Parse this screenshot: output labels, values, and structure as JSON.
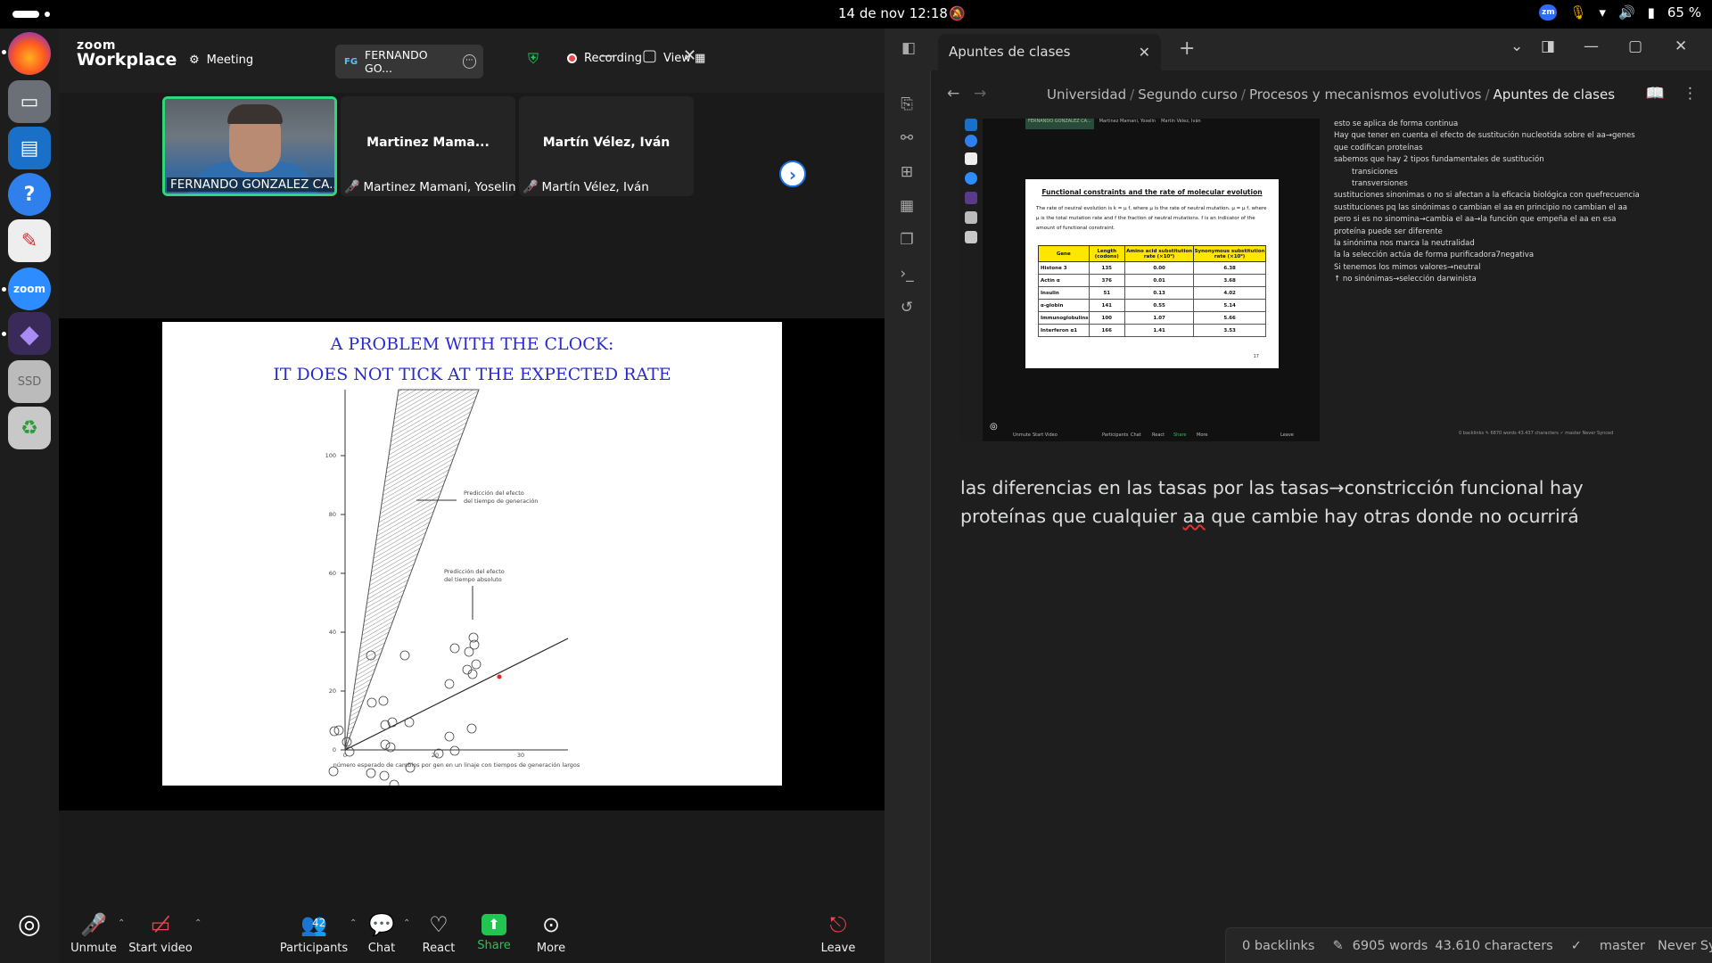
{
  "topbar": {
    "date_time": "14 de nov  12:18",
    "battery": "65 %",
    "zoom_tray": "zm"
  },
  "dock": {
    "items": [
      "firefox-icon",
      "files-icon",
      "writer-icon",
      "help-icon",
      "text-editor-icon",
      "zoom-icon",
      "obsidian-icon",
      "ssd-drive-icon",
      "trash-icon",
      "ubuntu-apps-icon"
    ],
    "zoom_label": "zoom",
    "ssd_label": "SSD"
  },
  "zoom": {
    "logo_top": "zoom",
    "logo_bottom": "Workplace",
    "meeting_label": "Meeting",
    "pill_initials": "FG",
    "pill_name": "FERNANDO GO...",
    "recording_label": "Recording",
    "view_label": "View",
    "participants_tiles": [
      {
        "label": "FERNANDO GONZALEZ CA..."
      },
      {
        "center": "Martinez Mama...",
        "label": "Martinez Mamani, Yoselin"
      },
      {
        "center": "Martín Vélez, Iván",
        "label": "Martín Vélez, Iván"
      }
    ],
    "slide": {
      "title_line1": "A PROBLEM WITH THE CLOCK:",
      "title_line2": "IT DOES NOT TICK AT THE EXPECTED RATE",
      "annotation_generation": "Predicción del efecto\ndel tiempo de generación",
      "annotation_absolute": "Predicción del efecto\ndel tiempo absoluto",
      "xlabel": "número esperado de cambios por gen en un linaje con tiempos de generación largos",
      "y_ticks": [
        "0",
        "20",
        "40",
        "60",
        "80",
        "100"
      ],
      "x_ticks": [
        "0",
        "20",
        "30"
      ]
    },
    "toolbar": {
      "unmute": "Unmute",
      "start_video": "Start video",
      "participants": "Participants",
      "participants_count": "42",
      "chat": "Chat",
      "react": "React",
      "share": "Share",
      "more": "More",
      "leave": "Leave"
    }
  },
  "obsidian": {
    "tab_title": "Apuntes de clases",
    "breadcrumb": [
      "Universidad",
      "Segundo curso",
      "Procesos y mecanismos evolutivos",
      "Apuntes de clases"
    ],
    "embed": {
      "slide_title": "Functional constraints and the rate of molecular evolution",
      "slide_text": "The rate of neutral evolution is k = μ f, where μ is the rate of neutral mutation. μ = μ f, where μ is the total mutation rate and f the fraction of neutral mutations. f is an indicator of the amount of functional constraint.",
      "table_headers": [
        "Gene",
        "Length (codons)",
        "Amino acid substitution rate (×10⁹)",
        "Synonymous substitution rate (×10⁹)"
      ],
      "table_rows": [
        [
          "Histone 3",
          "135",
          "0.00",
          "6.38"
        ],
        [
          "Actin α",
          "376",
          "0.01",
          "3.68"
        ],
        [
          "Insulin",
          "51",
          "0.13",
          "4.02"
        ],
        [
          "α-globin",
          "141",
          "0.55",
          "5.14"
        ],
        [
          "Immunoglobulins",
          "100",
          "1.07",
          "5.66"
        ],
        [
          "Interferon α1",
          "166",
          "1.41",
          "3.53"
        ]
      ],
      "slide_page": "17",
      "mini_header": [
        "FERNANDO GONZALEZ CA...",
        "Martinez Mamani, Yoselin",
        "Martín Vélez, Iván"
      ],
      "mini_toolbar": [
        "Unmute",
        "Start Video",
        "Participants",
        "Chat",
        "React",
        "Share",
        "More",
        "Leave"
      ],
      "notes": [
        {
          "text": "esto se aplica de forma continua",
          "indent": false
        },
        {
          "text": "Hay que tener en cuenta el efecto de sustitución nucleotida sobre el aa→genes",
          "indent": false
        },
        {
          "text": "que codifican proteínas",
          "indent": false
        },
        {
          "text": "sabemos que hay 2 tipos fundamentales de sustitución",
          "indent": false
        },
        {
          "text": "transiciones",
          "indent": true
        },
        {
          "text": "transversiones",
          "indent": true
        },
        {
          "text": "sustituciones sinonimas o no si afectan  a la eficacia biológica con quefrecuencia",
          "indent": false
        },
        {
          "text": "sustituciones pq las sinónimas o cambian el aa en principio no cambian el aa",
          "indent": false
        },
        {
          "text": "pero  si es no sinomina→cambia el  aa→la función que empeña el aa en esa",
          "indent": false
        },
        {
          "text": "proteína puede ser diferente",
          "indent": false
        },
        {
          "text": "la sinónima nos marca la  neutralidad",
          "indent": false
        },
        {
          "text": "la la selección actúa de forma purificadora7negativa",
          "indent": false
        },
        {
          "text": "Si tenemos los mimos valores→neutral",
          "indent": false
        },
        {
          "text": "↑ no sinónimas→selección darwinista",
          "indent": false
        }
      ],
      "mini_status": "0 backlinks  ✎ 6870 words  43.437 characters  ✓  master  Never Synced"
    },
    "paragraph_part1": "las diferencias en las tasas por las tasas→constricción funcional hay proteínas que cualquier ",
    "paragraph_aa": "aa",
    "paragraph_part2": " que cambie hay otras donde no ocurrirá",
    "status": {
      "backlinks": "0 backlinks",
      "words": "6905 words",
      "characters": "43.610 characters",
      "branch": "master",
      "sync": "Never Synced"
    }
  }
}
